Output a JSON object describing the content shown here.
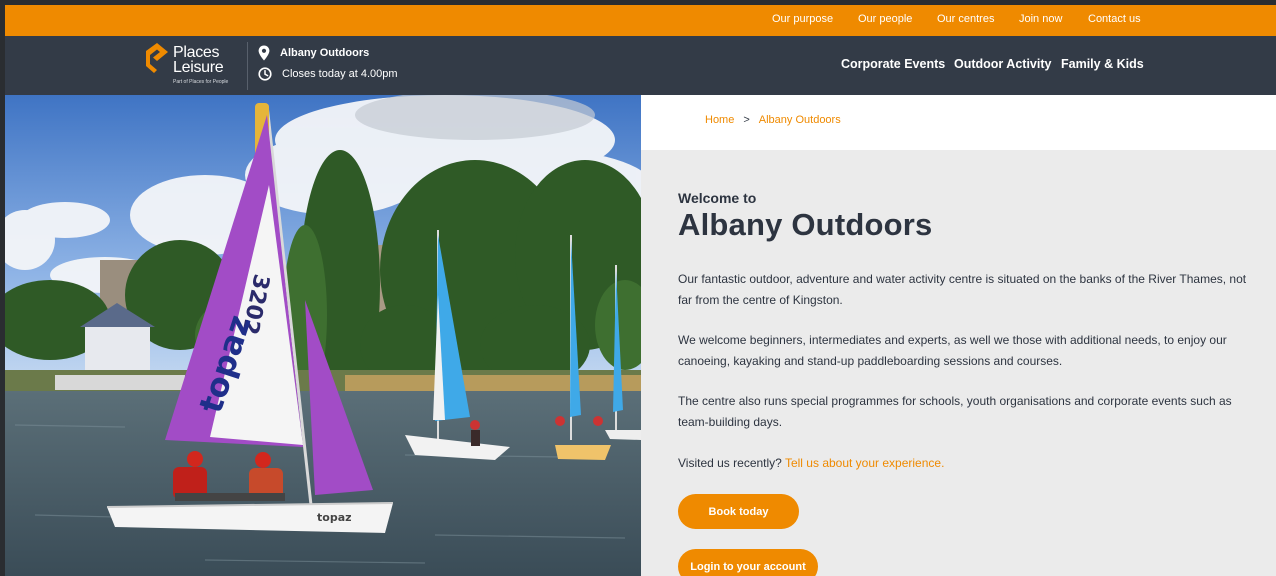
{
  "topbar": {
    "links": [
      "Our purpose",
      "Our people",
      "Our centres",
      "Join now",
      "Contact us"
    ]
  },
  "brand": {
    "name_line1": "Places",
    "name_line2": "Leisure",
    "tagline": "Part of Places for People",
    "accent": "#ef8a00",
    "header_bg": "#333b47"
  },
  "location": {
    "name": "Albany Outdoors",
    "hours": "Closes today at 4.00pm",
    "icons": [
      "map-pin-icon",
      "clock-icon"
    ]
  },
  "mainnav": {
    "items": [
      "Corporate Events",
      "Outdoor Activity",
      "Family & Kids"
    ]
  },
  "breadcrumb": {
    "home": "Home",
    "separator": ">",
    "current": "Albany Outdoors"
  },
  "main": {
    "welcome": "Welcome to",
    "title": "Albany Outdoors",
    "paragraphs": [
      "Our fantastic outdoor, adventure and water activity centre is situated on the banks of the River Thames, not far from the centre of Kingston.",
      "We welcome beginners, intermediates and experts, as well we those with additional needs, to enjoy our canoeing, kayaking and stand-up paddleboarding sessions and courses.",
      "The centre also runs special programmes for schools, youth organisations and corporate events such as team-building days."
    ],
    "visited_text": "Visited us recently?",
    "visited_link": "Tell us about your experience.",
    "book_button": "Book today",
    "login_button": "Login to your account"
  },
  "hero": {
    "sail_number": "3202",
    "boat_brand": "topaz"
  }
}
